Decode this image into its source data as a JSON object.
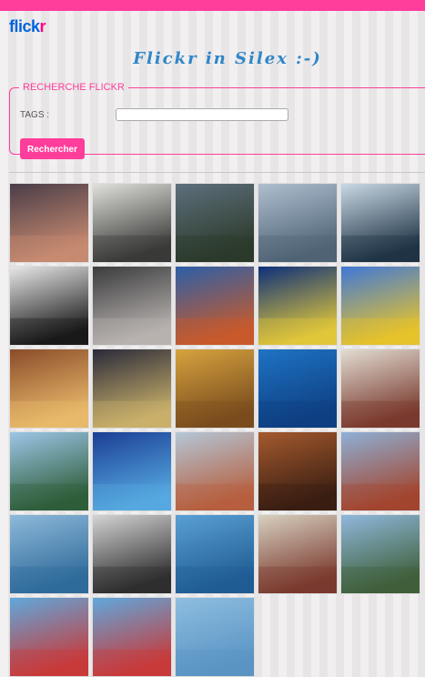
{
  "header": {
    "logo_part1": "flick",
    "logo_part2": "r",
    "title": "Flickr in Silex :-)"
  },
  "search": {
    "legend": "Recherche Flickr",
    "tags_label": "TAGS :",
    "tags_value": "",
    "button_label": "Rechercher"
  },
  "photos": [
    {
      "name": "photo-coastal-cliff-sunset",
      "bg": [
        "#4a3d48",
        "#c78a70"
      ]
    },
    {
      "name": "photo-doorway-silhouette",
      "bg": [
        "#e0e0dc",
        "#3a3a38"
      ]
    },
    {
      "name": "photo-cloudy-sky-landscape",
      "bg": [
        "#5d6f7c",
        "#2c3a2a"
      ]
    },
    {
      "name": "photo-golden-gate-fog",
      "bg": [
        "#aebfcf",
        "#4f6376"
      ]
    },
    {
      "name": "photo-bridge-underside",
      "bg": [
        "#c9d8e4",
        "#1f3446"
      ]
    },
    {
      "name": "photo-backpack-climber",
      "bg": [
        "#e8e8e8",
        "#1a1a1a"
      ]
    },
    {
      "name": "photo-mannequin-head",
      "bg": [
        "#3b3b3d",
        "#b8b3b0"
      ]
    },
    {
      "name": "photo-golden-gate-sunset",
      "bg": [
        "#2c5fa8",
        "#c85a2a"
      ]
    },
    {
      "name": "photo-victorian-houses-night",
      "bg": [
        "#0d2f7a",
        "#e0c63a"
      ]
    },
    {
      "name": "photo-yellow-building",
      "bg": [
        "#3f78d8",
        "#e6c22c"
      ]
    },
    {
      "name": "photo-bookstore-interior",
      "bg": [
        "#8a4c2a",
        "#e9b96a"
      ]
    },
    {
      "name": "photo-alley-shadows",
      "bg": [
        "#2a2a3a",
        "#c9b06a"
      ]
    },
    {
      "name": "photo-yellow-corridor",
      "bg": [
        "#d6a33e",
        "#7a4c1e"
      ]
    },
    {
      "name": "photo-blue-wires",
      "bg": [
        "#1e73c4",
        "#0e3f82"
      ]
    },
    {
      "name": "photo-man-carrying-sack",
      "bg": [
        "#e2ddd3",
        "#7a3a2e"
      ]
    },
    {
      "name": "photo-tree-bay-view",
      "bg": [
        "#9cc6e8",
        "#2f5e3a"
      ]
    },
    {
      "name": "photo-city-fountain-dusk",
      "bg": [
        "#1b3e95",
        "#55a8e0"
      ]
    },
    {
      "name": "photo-street-building",
      "bg": [
        "#b4c7d8",
        "#b65f3e"
      ]
    },
    {
      "name": "photo-elderly-face",
      "bg": [
        "#a45a2e",
        "#3a1e12"
      ]
    },
    {
      "name": "photo-church-fountain",
      "bg": [
        "#8db0d6",
        "#a3452e"
      ]
    },
    {
      "name": "photo-bay-bridge-blue",
      "bg": [
        "#8eb9da",
        "#2f6b9a"
      ]
    },
    {
      "name": "photo-group-bw",
      "bg": [
        "#d4d4d4",
        "#2e2e2e"
      ]
    },
    {
      "name": "photo-sailboat-water",
      "bg": [
        "#5aa0d4",
        "#1f5c94"
      ]
    },
    {
      "name": "photo-crowd-building",
      "bg": [
        "#d7d0c0",
        "#7a3a2e"
      ]
    },
    {
      "name": "photo-group-outdoors",
      "bg": [
        "#8fb8dc",
        "#3f5f3a"
      ]
    },
    {
      "name": "photo-carousel-1",
      "bg": [
        "#5fa8dc",
        "#c83a3a"
      ]
    },
    {
      "name": "photo-carousel-2",
      "bg": [
        "#5fa8dc",
        "#c83a3a"
      ]
    },
    {
      "name": "photo-blue-sky-3",
      "bg": [
        "#8ebee0",
        "#5a94c4"
      ]
    }
  ]
}
